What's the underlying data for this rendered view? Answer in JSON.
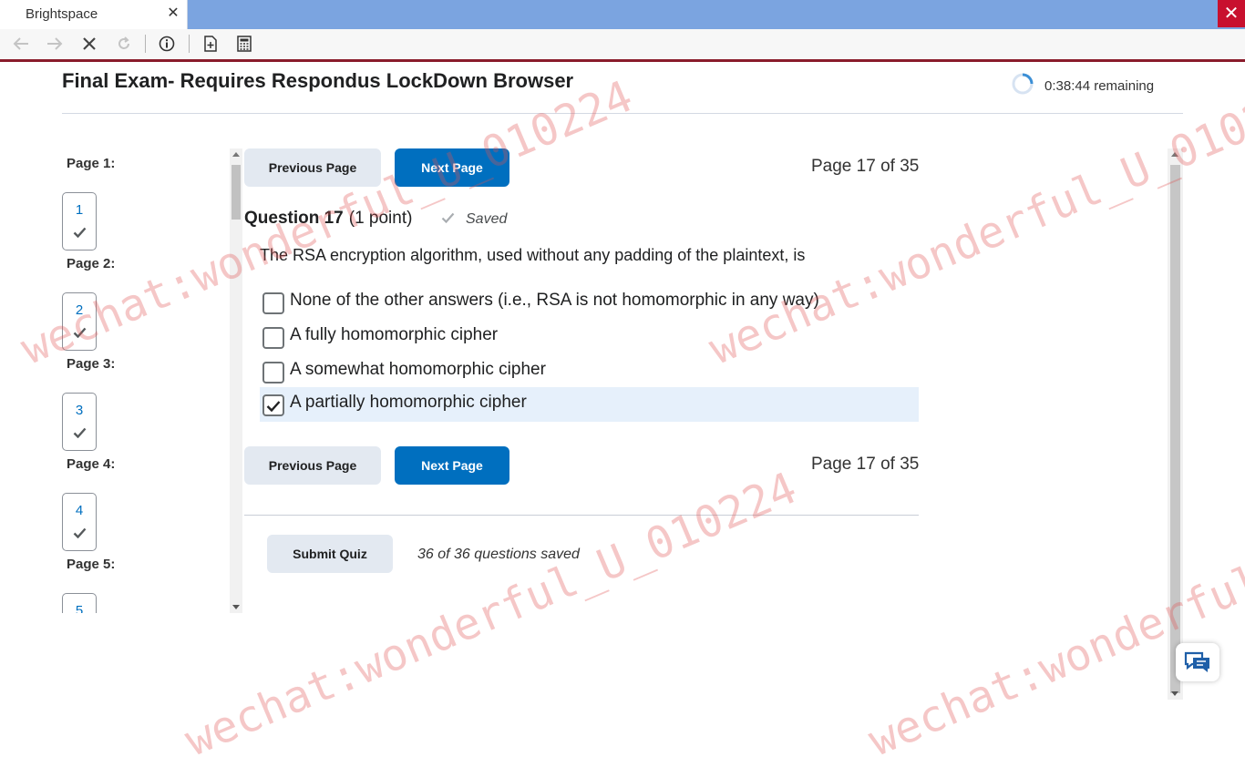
{
  "browser": {
    "tab_title": "Brightspace",
    "tab_close": "✕",
    "window_close": "✕"
  },
  "header": {
    "title": "Final Exam- Requires Respondus LockDown Browser",
    "timer": "0:38:44 remaining"
  },
  "nav": {
    "pages": [
      {
        "label": "Page 1:",
        "num": "1",
        "answered": true
      },
      {
        "label": "Page 2:",
        "num": "2",
        "answered": true
      },
      {
        "label": "Page 3:",
        "num": "3",
        "answered": true
      },
      {
        "label": "Page 4:",
        "num": "4",
        "answered": true
      },
      {
        "label": "Page 5:",
        "num": "5",
        "answered": false
      }
    ]
  },
  "main": {
    "prev_label": "Previous Page",
    "next_label": "Next Page",
    "page_indicator": "Page 17 of 35",
    "question": {
      "number": "Question 17",
      "points": "(1 point)",
      "status": "Saved",
      "text": "The RSA encryption algorithm, used without any padding of the plaintext, is",
      "options": [
        {
          "label": "None of the other answers (i.e., RSA is not homomorphic in any way)",
          "checked": false
        },
        {
          "label": "A fully homomorphic cipher",
          "checked": false
        },
        {
          "label": "A somewhat homomorphic cipher",
          "checked": false
        },
        {
          "label": "A partially homomorphic cipher",
          "checked": true
        }
      ]
    },
    "submit_label": "Submit Quiz",
    "saved_count": "36 of 36 questions saved"
  },
  "watermark": "wechat:wonderful_U_010224",
  "colors": {
    "primary": "#006fbf",
    "tabbar": "#7ba4e0",
    "accent_red": "#8a1c2b",
    "selected_bg": "#e6f0fb"
  }
}
